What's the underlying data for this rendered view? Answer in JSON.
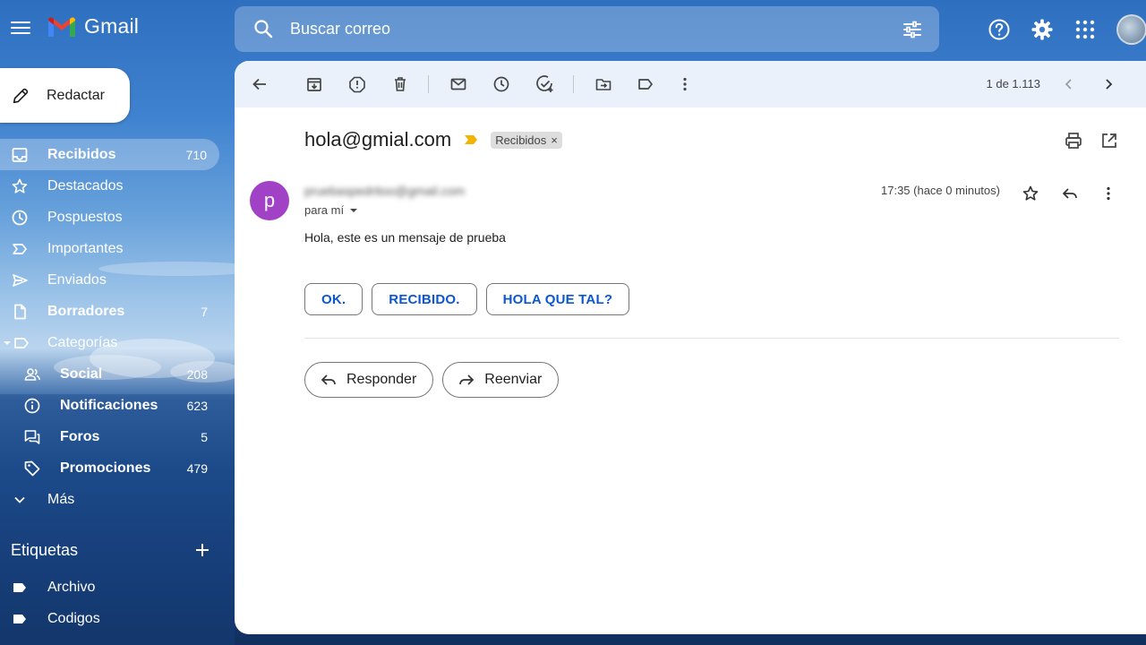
{
  "header": {
    "app_name": "Gmail",
    "search_placeholder": "Buscar correo"
  },
  "compose_label": "Redactar",
  "sidebar": {
    "items": [
      {
        "label": "Recibidos",
        "count": "710"
      },
      {
        "label": "Destacados",
        "count": ""
      },
      {
        "label": "Pospuestos",
        "count": ""
      },
      {
        "label": "Importantes",
        "count": ""
      },
      {
        "label": "Enviados",
        "count": ""
      },
      {
        "label": "Borradores",
        "count": "7"
      },
      {
        "label": "Categorías",
        "count": ""
      },
      {
        "label": "Social",
        "count": "208"
      },
      {
        "label": "Notificaciones",
        "count": "623"
      },
      {
        "label": "Foros",
        "count": "5"
      },
      {
        "label": "Promociones",
        "count": "479"
      },
      {
        "label": "Más",
        "count": ""
      }
    ],
    "labels_title": "Etiquetas",
    "labels": [
      "Archivo",
      "Codigos"
    ]
  },
  "toolbar": {
    "pager": "1 de 1.113"
  },
  "message": {
    "subject": "hola@gmial.com",
    "label_chip": "Recibidos",
    "chip_close": "×",
    "sender_initial": "p",
    "sender_email": "pruebaspedritoo@gmail.com",
    "to_line": "para mí",
    "timestamp": "17:35 (hace 0 minutos)",
    "body": "Hola, este es un mensaje de prueba"
  },
  "smart_replies": [
    "OK.",
    "RECIBIDO.",
    "HOLA QUE TAL?"
  ],
  "actions": {
    "reply": "Responder",
    "forward": "Reenviar"
  },
  "colors": {
    "accent_blue": "#0b57d0",
    "avatar_purple": "#a142c6",
    "toolbar_bg": "#eaf1fb",
    "important_marker": "#f2b400"
  }
}
